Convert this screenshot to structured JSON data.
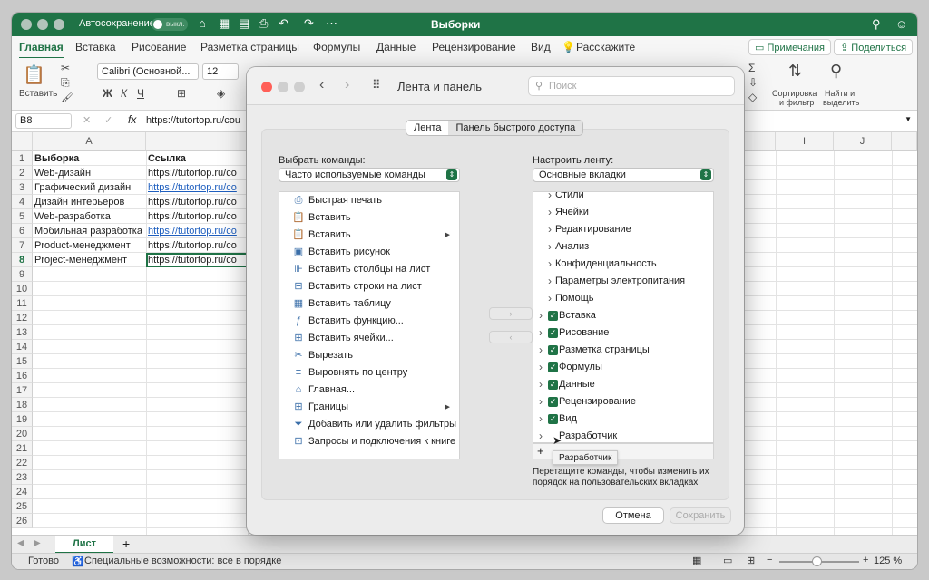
{
  "window": {
    "autosave_label": "Автосохранение",
    "autosave_state": "выкл.",
    "document_title": "Выборки"
  },
  "ribbon_tabs": [
    "Главная",
    "Вставка",
    "Рисование",
    "Разметка страницы",
    "Формулы",
    "Данные",
    "Рецензирование",
    "Вид"
  ],
  "tell_me": "Расскажите",
  "comments_button": "Примечания",
  "share_button": "Поделиться",
  "ribbon": {
    "paste_label": "Вставить",
    "font_name": "Calibri (Основной...",
    "font_size": "12",
    "sort_label_1": "Сортировка",
    "sort_label_2": "и фильтр",
    "find_label_1": "Найти и",
    "find_label_2": "выделить"
  },
  "formula_bar": {
    "name_box": "B8",
    "fx": "fx",
    "formula": "https://tutortop.ru/cou"
  },
  "grid": {
    "columns": [
      "A",
      "I",
      "J"
    ],
    "rows": [
      "1",
      "2",
      "3",
      "4",
      "5",
      "6",
      "7",
      "8",
      "9",
      "10",
      "11",
      "12",
      "13",
      "14",
      "15",
      "16",
      "17",
      "18",
      "19",
      "20",
      "21",
      "22",
      "23",
      "24",
      "25",
      "26"
    ],
    "header_a": "Выборка",
    "header_b": "Ссылка",
    "items": [
      {
        "a": "Web-дизайн",
        "b": "https://tutortop.ru/co",
        "link": false
      },
      {
        "a": "Графический дизайн",
        "b": "https://tutortop.ru/co",
        "link": true
      },
      {
        "a": "Дизайн интерьеров",
        "b": "https://tutortop.ru/co",
        "link": false
      },
      {
        "a": "Web-разработка",
        "b": "https://tutortop.ru/co",
        "link": false
      },
      {
        "a": "Мобильная разработка",
        "b": "https://tutortop.ru/co",
        "link": true
      },
      {
        "a": "Product-менеджмент",
        "b": "https://tutortop.ru/co",
        "link": false
      },
      {
        "a": "Project-менеджмент",
        "b": "https://tutortop.ru/co",
        "link": false
      }
    ]
  },
  "sheet_tab": "Лист",
  "status": {
    "ready": "Готово",
    "accessibility": "Специальные возможности: все в порядке",
    "zoom": "125 %"
  },
  "dialog": {
    "title": "Лента и панель",
    "search_placeholder": "Поиск",
    "seg_ribbon": "Лента",
    "seg_quick": "Панель быстрого доступа",
    "choose_label": "Выбрать команды:",
    "choose_value": "Часто используемые команды",
    "customize_label": "Настроить ленту:",
    "customize_value": "Основные вкладки",
    "commands": [
      {
        "icon": "⎙",
        "label": "Быстрая печать",
        "sub": false
      },
      {
        "icon": "📋",
        "label": "Вставить",
        "sub": false
      },
      {
        "icon": "📋",
        "label": "Вставить",
        "sub": true
      },
      {
        "icon": "▣",
        "label": "Вставить рисунок",
        "sub": false
      },
      {
        "icon": "⊪",
        "label": "Вставить столбцы на лист",
        "sub": false
      },
      {
        "icon": "⊟",
        "label": "Вставить строки на лист",
        "sub": false
      },
      {
        "icon": "▦",
        "label": "Вставить таблицу",
        "sub": false
      },
      {
        "icon": "ƒ",
        "label": "Вставить функцию...",
        "sub": false
      },
      {
        "icon": "⊞",
        "label": "Вставить ячейки...",
        "sub": false
      },
      {
        "icon": "✂",
        "label": "Вырезать",
        "sub": false
      },
      {
        "icon": "≡",
        "label": "Выровнять по центру",
        "sub": false
      },
      {
        "icon": "⌂",
        "label": "Главная...",
        "sub": false
      },
      {
        "icon": "⊞",
        "label": "Границы",
        "sub": true
      },
      {
        "icon": "⏷",
        "label": "Добавить или удалить фильтры",
        "sub": false
      },
      {
        "icon": "⊡",
        "label": "Запросы и подключения к книге",
        "sub": false
      }
    ],
    "ribbon_items": [
      {
        "label": "Стили",
        "level": 2,
        "checked": false
      },
      {
        "label": "Ячейки",
        "level": 2,
        "checked": false
      },
      {
        "label": "Редактирование",
        "level": 2,
        "checked": false
      },
      {
        "label": "Анализ",
        "level": 2,
        "checked": false
      },
      {
        "label": "Конфиденциальность",
        "level": 2,
        "checked": false
      },
      {
        "label": "Параметры электропитания",
        "level": 2,
        "checked": false
      },
      {
        "label": "Помощь",
        "level": 2,
        "checked": false
      },
      {
        "label": "Вставка",
        "level": 1,
        "checked": true
      },
      {
        "label": "Рисование",
        "level": 1,
        "checked": true
      },
      {
        "label": "Разметка страницы",
        "level": 1,
        "checked": true
      },
      {
        "label": "Формулы",
        "level": 1,
        "checked": true
      },
      {
        "label": "Данные",
        "level": 1,
        "checked": true
      },
      {
        "label": "Рецензирование",
        "level": 1,
        "checked": true
      },
      {
        "label": "Вид",
        "level": 1,
        "checked": true
      },
      {
        "label": "Разработчик",
        "level": 1,
        "checked": false
      }
    ],
    "add_symbol": "+",
    "tooltip": "Разработчик",
    "hint": "Перетащите команды, чтобы изменить их порядок на пользовательских вкладках",
    "cancel": "Отмена",
    "save": "Сохранить"
  }
}
